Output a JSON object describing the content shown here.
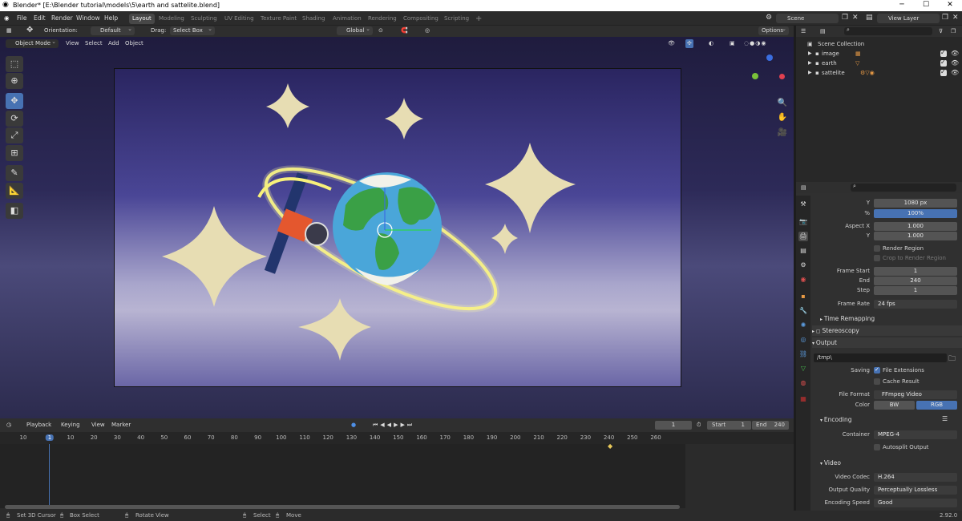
{
  "window": {
    "title": "Blender* [E:\\Blender tutorial\\models\\5\\earth and sattelite.blend]",
    "minimize": "─",
    "maximize": "☐",
    "close": "✕"
  },
  "menu": {
    "items": [
      "File",
      "Edit",
      "Render",
      "Window",
      "Help"
    ]
  },
  "workspaces": [
    "Layout",
    "Modeling",
    "Sculpting",
    "UV Editing",
    "Texture Paint",
    "Shading",
    "Animation",
    "Rendering",
    "Compositing",
    "Scripting",
    "+"
  ],
  "scene": {
    "label": "Scene",
    "view_layer": "View Layer"
  },
  "header3d": {
    "orientation_label": "Orientation:",
    "orientation_value": "Default",
    "drag_label": "Drag:",
    "drag_value": "Select Box",
    "mode": "Object Mode",
    "view": "View",
    "select": "Select",
    "add": "Add",
    "object": "Object",
    "transform": "Global",
    "options": "Options"
  },
  "outliner": {
    "root": "Scene Collection",
    "items": [
      {
        "name": "image"
      },
      {
        "name": "earth"
      },
      {
        "name": "sattelite"
      }
    ]
  },
  "properties": {
    "resolution_y_label": "Y",
    "resolution_y": "1080 px",
    "percent_label": "%",
    "percent": "100%",
    "aspect_x_label": "Aspect X",
    "aspect_x": "1.000",
    "aspect_y_label": "Y",
    "aspect_y": "1.000",
    "render_region": "Render Region",
    "crop_region": "Crop to Render Region",
    "frame_start_label": "Frame Start",
    "frame_start": "1",
    "end_label": "End",
    "end": "240",
    "step_label": "Step",
    "step": "1",
    "frame_rate_label": "Frame Rate",
    "frame_rate": "24 fps",
    "time_remapping": "Time Remapping",
    "stereoscopy": "Stereoscopy",
    "output": "Output",
    "output_path": "/tmp\\",
    "saving_label": "Saving",
    "file_extensions": "File Extensions",
    "cache_result": "Cache Result",
    "file_format_label": "File Format",
    "file_format": "FFmpeg Video",
    "color_label": "Color",
    "color_bw": "BW",
    "color_rgb": "RGB",
    "encoding": "Encoding",
    "container_label": "Container",
    "container": "MPEG-4",
    "autosplit": "Autosplit Output",
    "video": "Video",
    "video_codec_label": "Video Codec",
    "video_codec": "H.264",
    "output_quality_label": "Output Quality",
    "output_quality": "Perceptually Lossless",
    "encoding_speed_label": "Encoding Speed",
    "encoding_speed": "Good"
  },
  "timeline": {
    "playback": "Playback",
    "keying": "Keying",
    "view": "View",
    "marker": "Marker",
    "current_frame": "1",
    "start_label": "Start",
    "start": "1",
    "end_label": "End",
    "end": "240",
    "ruler": [
      "10",
      "1",
      "10",
      "20",
      "30",
      "40",
      "50",
      "60",
      "70",
      "80",
      "90",
      "100",
      "110",
      "120",
      "130",
      "140",
      "150",
      "160",
      "170",
      "180",
      "190",
      "200",
      "210",
      "220",
      "230",
      "240",
      "250",
      "260"
    ]
  },
  "status": {
    "set_cursor": "Set 3D Cursor",
    "box_select": "Box Select",
    "rotate_view": "Rotate View",
    "select": "Select",
    "move": "Move",
    "version": "2.92.0"
  },
  "colors": {
    "accent": "#4772b3",
    "selected_frame": "#4772b3",
    "star": "#e7ddb3",
    "ring": "#f7f07a",
    "earth_ocean": "#4aa6d9",
    "earth_land": "#3aa046"
  }
}
